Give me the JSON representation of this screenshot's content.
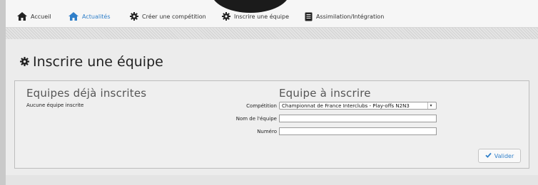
{
  "nav": {
    "items": [
      {
        "label": "Accueil",
        "icon": "home-icon"
      },
      {
        "label": "Actualités",
        "icon": "home-icon"
      },
      {
        "label": "Créer une compétition",
        "icon": "gear-icon"
      },
      {
        "label": "Inscrire une équipe",
        "icon": "gear-icon"
      },
      {
        "label": "Assimilation/Intégration",
        "icon": "document-icon"
      }
    ],
    "active_color": "#2f7fc9"
  },
  "page": {
    "title": "Inscrire une équipe",
    "title_icon": "gear-icon"
  },
  "registered": {
    "heading": "Equipes déjà inscrites",
    "empty_text": "Aucune équipe inscrite"
  },
  "form": {
    "heading": "Equipe à inscrire",
    "competition_label": "Compétition",
    "competition_value": "Championnat de France Interclubs - Play-offs N2N3",
    "team_name_label": "Nom de l'équipe",
    "team_name_value": "",
    "number_label": "Numéro",
    "number_value": "",
    "submit_label": "Valider",
    "submit_icon": "check-icon"
  }
}
